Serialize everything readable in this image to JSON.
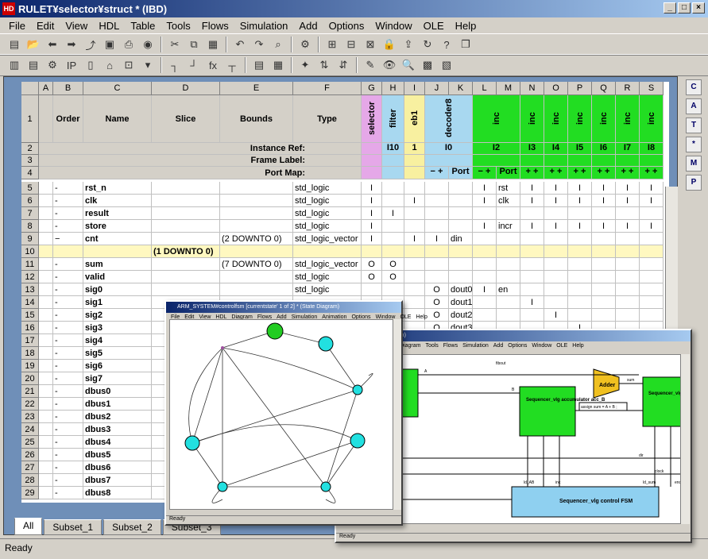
{
  "app": {
    "title": "RULET¥selector¥struct * (IBD)",
    "icon": "HDL-Designer-icon"
  },
  "menu": [
    "File",
    "Edit",
    "View",
    "HDL",
    "Table",
    "Tools",
    "Flows",
    "Simulation",
    "Add",
    "Options",
    "Window",
    "OLE",
    "Help"
  ],
  "columns": [
    "A",
    "B",
    "C",
    "D",
    "E",
    "F",
    "G",
    "H",
    "I",
    "J",
    "K",
    "L",
    "M",
    "N",
    "O",
    "P",
    "Q",
    "R",
    "S"
  ],
  "header": {
    "order": "Order",
    "name": "Name",
    "slice": "Slice",
    "bounds": "Bounds",
    "type": "Type",
    "instance_ref": "Instance Ref:",
    "frame_label": "Frame Label:",
    "port_map": "Port Map:",
    "instances": [
      {
        "name": "selector",
        "ref": "",
        "color": "#e5a8e8"
      },
      {
        "name": "filter",
        "ref": "I10",
        "color": "#a8d8f0"
      },
      {
        "name": "eb1",
        "ref": "1",
        "color": "#f8f0a0"
      },
      {
        "name": "decoder8",
        "ref": "I0",
        "color": "#a8d8f0"
      },
      {
        "name": "inc",
        "ref": "I2",
        "color": "#22dd22"
      },
      {
        "name": "inc",
        "ref": "I3",
        "color": "#22dd22"
      },
      {
        "name": "inc",
        "ref": "I4",
        "color": "#22dd22"
      },
      {
        "name": "inc",
        "ref": "I5",
        "color": "#22dd22"
      },
      {
        "name": "inc",
        "ref": "I6",
        "color": "#22dd22"
      },
      {
        "name": "inc",
        "ref": "I7",
        "color": "#22dd22"
      },
      {
        "name": "inc",
        "ref": "I8",
        "color": "#22dd22"
      }
    ],
    "portmap": [
      "",
      "",
      "",
      "− +",
      "Port",
      "− +",
      "Port",
      "+ +",
      "+ +",
      "+ +",
      "+ +",
      "+ +",
      "+ +"
    ]
  },
  "rows": [
    {
      "n": "5",
      "order": "-",
      "name": "rst_n",
      "slice": "",
      "bounds": "",
      "type": "std_logic",
      "g": "I",
      "h": "",
      "i": "",
      "j": "",
      "k": "",
      "l": "I",
      "m": "rst",
      "nn": "I",
      "o": "I",
      "p": "I",
      "q": "I",
      "r": "I",
      "s": "I"
    },
    {
      "n": "6",
      "order": "-",
      "name": "clk",
      "slice": "",
      "bounds": "",
      "type": "std_logic",
      "g": "I",
      "h": "",
      "i": "I",
      "j": "",
      "k": "",
      "l": "I",
      "m": "clk",
      "nn": "I",
      "o": "I",
      "p": "I",
      "q": "I",
      "r": "I",
      "s": "I"
    },
    {
      "n": "7",
      "order": "-",
      "name": "result",
      "slice": "",
      "bounds": "",
      "type": "std_logic",
      "g": "I",
      "h": "I",
      "i": "",
      "j": "",
      "k": "",
      "l": "",
      "m": "",
      "nn": "",
      "o": "",
      "p": "",
      "q": "",
      "r": "",
      "s": ""
    },
    {
      "n": "8",
      "order": "-",
      "name": "store",
      "slice": "",
      "bounds": "",
      "type": "std_logic",
      "g": "I",
      "h": "",
      "i": "",
      "j": "",
      "k": "",
      "l": "I",
      "m": "incr",
      "nn": "I",
      "o": "I",
      "p": "I",
      "q": "I",
      "r": "I",
      "s": "I"
    },
    {
      "n": "9",
      "order": "−",
      "name": "cnt",
      "slice": "",
      "bounds": "(2 DOWNTO 0)",
      "type": "std_logic_vector",
      "g": "I",
      "h": "",
      "i": "I",
      "j": "I",
      "k": "din",
      "l": "",
      "m": "",
      "nn": "",
      "o": "",
      "p": "",
      "q": "",
      "r": "",
      "s": ""
    },
    {
      "n": "10",
      "order": "",
      "name": "",
      "slice": "(1 DOWNTO 0)",
      "bounds": "",
      "type": "",
      "g": "",
      "h": "",
      "i": "",
      "j": "",
      "k": "",
      "l": "",
      "m": "",
      "nn": "",
      "o": "",
      "p": "",
      "q": "",
      "r": "",
      "s": "",
      "yellow": true
    },
    {
      "n": "11",
      "order": "-",
      "name": "sum",
      "slice": "",
      "bounds": "(7 DOWNTO 0)",
      "type": "std_logic_vector",
      "g": "O",
      "h": "O",
      "i": "",
      "j": "",
      "k": "",
      "l": "",
      "m": "",
      "nn": "",
      "o": "",
      "p": "",
      "q": "",
      "r": "",
      "s": ""
    },
    {
      "n": "12",
      "order": "-",
      "name": "valid",
      "slice": "",
      "bounds": "",
      "type": "std_logic",
      "g": "O",
      "h": "O",
      "i": "",
      "j": "",
      "k": "",
      "l": "",
      "m": "",
      "nn": "",
      "o": "",
      "p": "",
      "q": "",
      "r": "",
      "s": ""
    },
    {
      "n": "13",
      "order": "-",
      "name": "sig0",
      "slice": "",
      "bounds": "",
      "type": "std_logic",
      "g": "",
      "h": "",
      "i": "",
      "j": "O",
      "k": "dout0",
      "l": "I",
      "m": "en",
      "nn": "",
      "o": "",
      "p": "",
      "q": "",
      "r": "",
      "s": ""
    },
    {
      "n": "14",
      "order": "-",
      "name": "sig1",
      "slice": "",
      "bounds": "",
      "type": "",
      "g": "",
      "h": "",
      "i": "",
      "j": "O",
      "k": "dout1",
      "l": "",
      "m": "",
      "nn": "I",
      "o": "",
      "p": "",
      "q": "",
      "r": "",
      "s": ""
    },
    {
      "n": "15",
      "order": "-",
      "name": "sig2",
      "slice": "",
      "bounds": "",
      "type": "",
      "g": "",
      "h": "",
      "i": "",
      "j": "O",
      "k": "dout2",
      "l": "",
      "m": "",
      "nn": "",
      "o": "I",
      "p": "",
      "q": "",
      "r": "",
      "s": ""
    },
    {
      "n": "16",
      "order": "-",
      "name": "sig3",
      "slice": "",
      "bounds": "",
      "type": "",
      "g": "",
      "h": "",
      "i": "",
      "j": "O",
      "k": "dout3",
      "l": "",
      "m": "",
      "nn": "",
      "o": "",
      "p": "I",
      "q": "",
      "r": "",
      "s": ""
    },
    {
      "n": "17",
      "order": "-",
      "name": "sig4"
    },
    {
      "n": "18",
      "order": "-",
      "name": "sig5"
    },
    {
      "n": "19",
      "order": "-",
      "name": "sig6"
    },
    {
      "n": "20",
      "order": "-",
      "name": "sig7"
    },
    {
      "n": "21",
      "order": "-",
      "name": "dbus0"
    },
    {
      "n": "22",
      "order": "-",
      "name": "dbus1"
    },
    {
      "n": "23",
      "order": "-",
      "name": "dbus2"
    },
    {
      "n": "24",
      "order": "-",
      "name": "dbus3"
    },
    {
      "n": "25",
      "order": "-",
      "name": "dbus4"
    },
    {
      "n": "26",
      "order": "-",
      "name": "dbus5"
    },
    {
      "n": "27",
      "order": "-",
      "name": "dbus6"
    },
    {
      "n": "28",
      "order": "-",
      "name": "dbus7"
    },
    {
      "n": "29",
      "order": "-",
      "name": "dbus8"
    }
  ],
  "tabs": [
    "All",
    "Subset_1",
    "Subset_2",
    "Subset_3"
  ],
  "status": "Ready",
  "state_win": {
    "title": "ARM_SYSTEM#controlfsm [currentstate' 1 of 2] * (State Diagram)",
    "menu": [
      "File",
      "Edit",
      "View",
      "HDL",
      "Diagram",
      "Flows",
      "Add",
      "Simulation",
      "Animation",
      "Options",
      "Window",
      "OLE",
      "Help"
    ],
    "status": "Ready"
  },
  "block_win": {
    "title": "struct * (Block Diagram)",
    "menu": [
      "Diagram",
      "Tools",
      "Flows",
      "Simulation",
      "Add",
      "Options",
      "Window",
      "OLE",
      "Help"
    ],
    "status": "Ready",
    "blocks": [
      {
        "label": "Sequencer_vlg accumulator acc_B"
      },
      {
        "label": "Sequencer_vlg accumulator acc_sum"
      },
      {
        "label": "Sequencer_vlg control FSM"
      }
    ],
    "adder": "Adder",
    "assign": "assign sum = A + B ;",
    "nets": [
      "A",
      "B",
      "sum",
      "fibout",
      "dir",
      "clock",
      "ld_AB",
      "inc",
      "ld_sum",
      "end"
    ]
  },
  "right_panel": [
    "C",
    "A",
    "T",
    "*",
    "M",
    "P"
  ]
}
